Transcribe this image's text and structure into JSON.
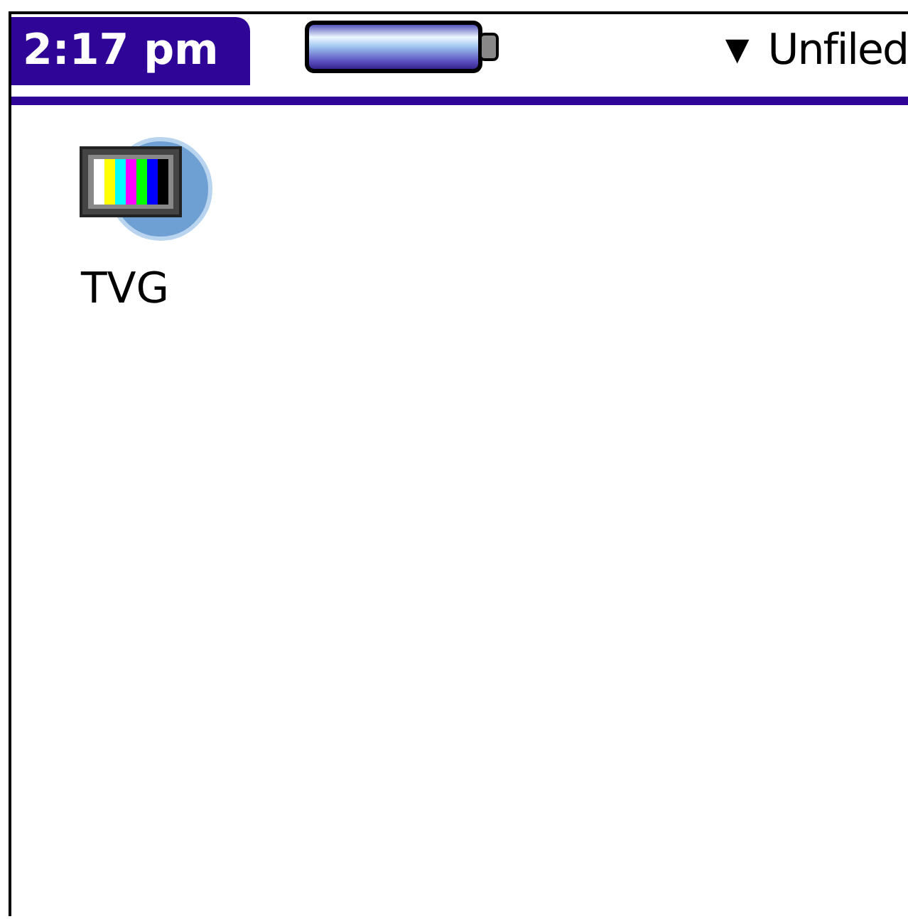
{
  "status_bar": {
    "time": "2:17 pm",
    "category_arrow": "▼",
    "category": "Unfiled"
  },
  "apps": [
    {
      "name": "TVG"
    }
  ]
}
